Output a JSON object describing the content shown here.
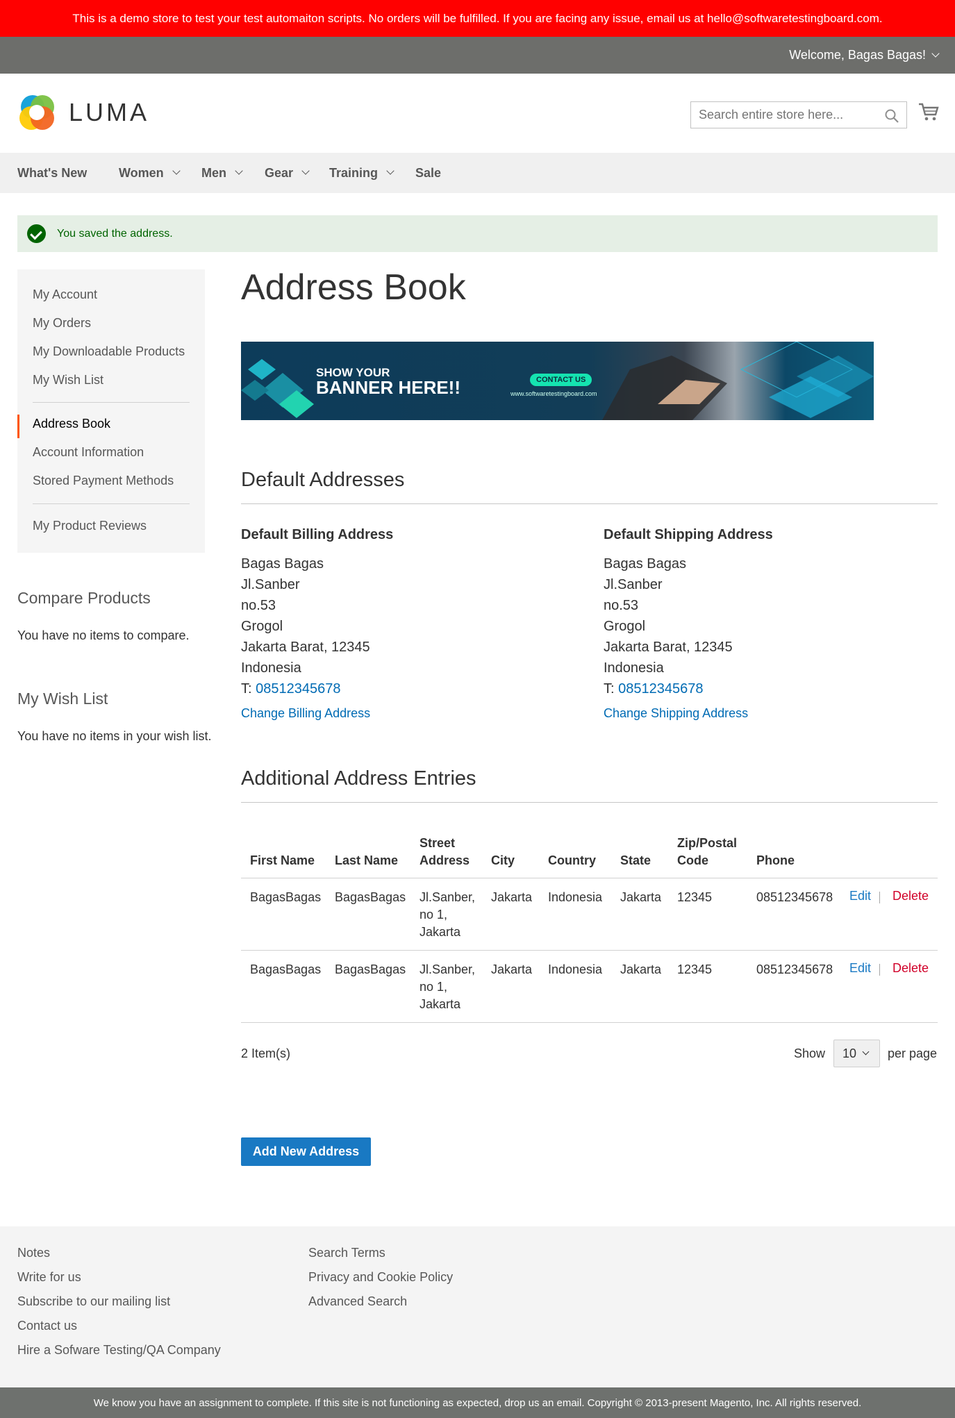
{
  "demo_notice": "This is a demo store to test your test automaiton scripts. No orders will be fulfilled. If you are facing any issue, email us at hello@softwaretestingboard.com.",
  "panel": {
    "welcome": "Welcome, Bagas Bagas!"
  },
  "header": {
    "logo_text": "LUMA",
    "search": {
      "placeholder": "Search entire store here...",
      "value": ""
    }
  },
  "nav": {
    "items": [
      {
        "label": "What's New"
      },
      {
        "label": "Women"
      },
      {
        "label": "Men"
      },
      {
        "label": "Gear"
      },
      {
        "label": "Training"
      },
      {
        "label": "Sale"
      }
    ]
  },
  "message": "You saved the address.",
  "sidebar": {
    "items": [
      {
        "label": "My Account"
      },
      {
        "label": "My Orders"
      },
      {
        "label": "My Downloadable Products"
      },
      {
        "label": "My Wish List"
      },
      {
        "label": "Address Book"
      },
      {
        "label": "Account Information"
      },
      {
        "label": "Stored Payment Methods"
      },
      {
        "label": "My Product Reviews"
      }
    ],
    "active": "Address Book"
  },
  "compare": {
    "title": "Compare Products",
    "text": "You have no items to compare."
  },
  "wishlist": {
    "title": "My Wish List",
    "text": "You have no items in your wish list."
  },
  "page_title": "Address Book",
  "banner": {
    "line1": "SHOW YOUR",
    "line2": "BANNER HERE!!",
    "button": "CONTACT US",
    "url": "www.softwaretestingboard.com"
  },
  "default_addresses": {
    "title": "Default Addresses",
    "billing": {
      "title": "Default Billing Address",
      "lines": [
        "Bagas Bagas",
        "Jl.Sanber",
        "no.53",
        "Grogol",
        "Jakarta Barat, 12345",
        "Indonesia"
      ],
      "phone_prefix": "T:",
      "phone": "08512345678",
      "change_link": "Change Billing Address"
    },
    "shipping": {
      "title": "Default Shipping Address",
      "lines": [
        "Bagas Bagas",
        "Jl.Sanber",
        "no.53",
        "Grogol",
        "Jakarta Barat, 12345",
        "Indonesia"
      ],
      "phone_prefix": "T:",
      "phone": "08512345678",
      "change_link": "Change Shipping Address"
    }
  },
  "additional": {
    "title": "Additional Address Entries",
    "headers": [
      "First Name",
      "Last Name",
      "Street Address",
      "City",
      "Country",
      "State",
      "Zip/Postal Code",
      "Phone"
    ],
    "rows": [
      {
        "first": "BagasBagas",
        "last": "BagasBagas",
        "street": [
          "Jl.Sanber,",
          "no 1,",
          "Jakarta"
        ],
        "city": "Jakarta",
        "country": "Indonesia",
        "state": "Jakarta",
        "zip": "12345",
        "phone": "08512345678",
        "edit": "Edit",
        "delete": "Delete"
      },
      {
        "first": "BagasBagas",
        "last": "BagasBagas",
        "street": [
          "Jl.Sanber,",
          "no 1,",
          "Jakarta"
        ],
        "city": "Jakarta",
        "country": "Indonesia",
        "state": "Jakarta",
        "zip": "12345",
        "phone": "08512345678",
        "edit": "Edit",
        "delete": "Delete"
      }
    ],
    "count": "2 Item(s)",
    "limiter": {
      "show": "Show",
      "value": "10",
      "per_page": "per page"
    }
  },
  "add_button": "Add New Address",
  "footer": {
    "col1": [
      "Notes",
      "Write for us",
      "Subscribe to our mailing list",
      "Contact us",
      "Hire a Sofware Testing/QA Company"
    ],
    "col2": [
      "Search Terms",
      "Privacy and Cookie Policy",
      "Advanced Search"
    ]
  },
  "copyright": "We know you have an assignment to complete. If this site is not functioning as expected, drop us an email. Copyright © 2013-present Magento, Inc. All rights reserved."
}
